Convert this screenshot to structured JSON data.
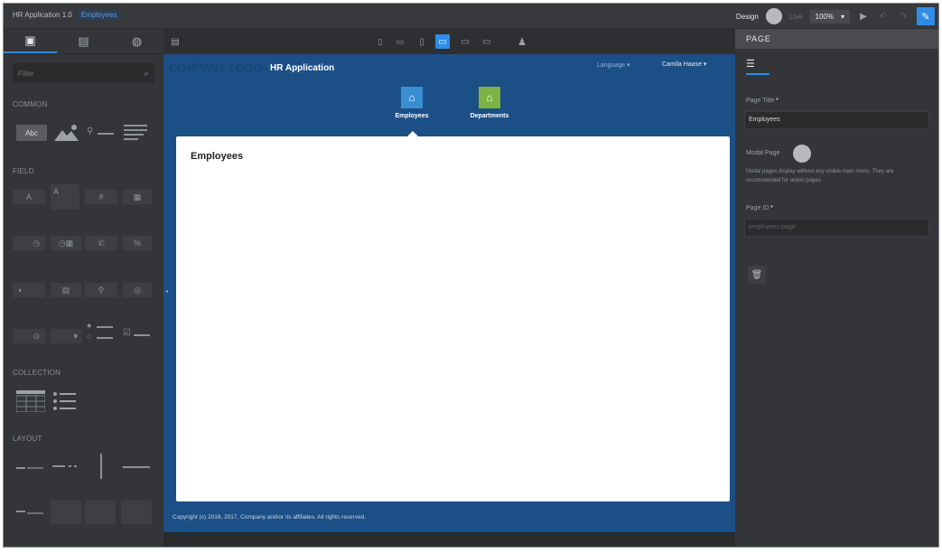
{
  "topbar": {
    "crumbs": [
      "HR Application 1.0",
      "Employees"
    ],
    "design_label": "Design",
    "live_label": "Live",
    "zoom": "100%",
    "zoom_caret": "▾",
    "play_icon": "play-icon",
    "undo_icon": "undo-icon",
    "redo_icon": "redo-icon",
    "edit_icon": "pencil-icon"
  },
  "palette": {
    "tabs": [
      "components-icon",
      "data-icon",
      "themes-icon"
    ],
    "filter_placeholder": "Filter",
    "sections": [
      "COMMON",
      "FIELD",
      "COLLECTION",
      "LAYOUT"
    ],
    "text_tile": "Abc",
    "field_glyphs": [
      "A",
      "A",
      "#",
      "◷",
      "◷▦",
      "✆",
      "%",
      "◐",
      "▤",
      "⚲",
      "◎",
      "⊙",
      "▾",
      "☑"
    ]
  },
  "canvas_toolbar": {
    "devices": [
      "phone-portrait-icon",
      "phone-landscape-icon",
      "tablet-portrait-icon",
      "tablet-landscape-icon",
      "laptop-icon",
      "desktop-icon",
      "user-icon"
    ]
  },
  "app": {
    "logo": "COMPANY LOGO",
    "title": "HR Application",
    "language": "Language ▾",
    "user": "Camila Haase ▾",
    "nav": [
      {
        "label": "Employees",
        "color": "#3a8fd3"
      },
      {
        "label": "Departments",
        "color": "#7cb342"
      }
    ],
    "page_title": "Employees",
    "footer": "Copyright (c) 2016, 2017, Company and/or its affiliates. All rights reserved."
  },
  "props": {
    "header": "PAGE",
    "page_title_label": "Page Title",
    "page_title_value": "Employees",
    "modal_label": "Modal Page",
    "modal_help": "Modal pages display without any visible main menu. They are recommended for action pages.",
    "page_id_label": "Page ID",
    "page_id_value": "employees-page",
    "required_mark": "*"
  }
}
